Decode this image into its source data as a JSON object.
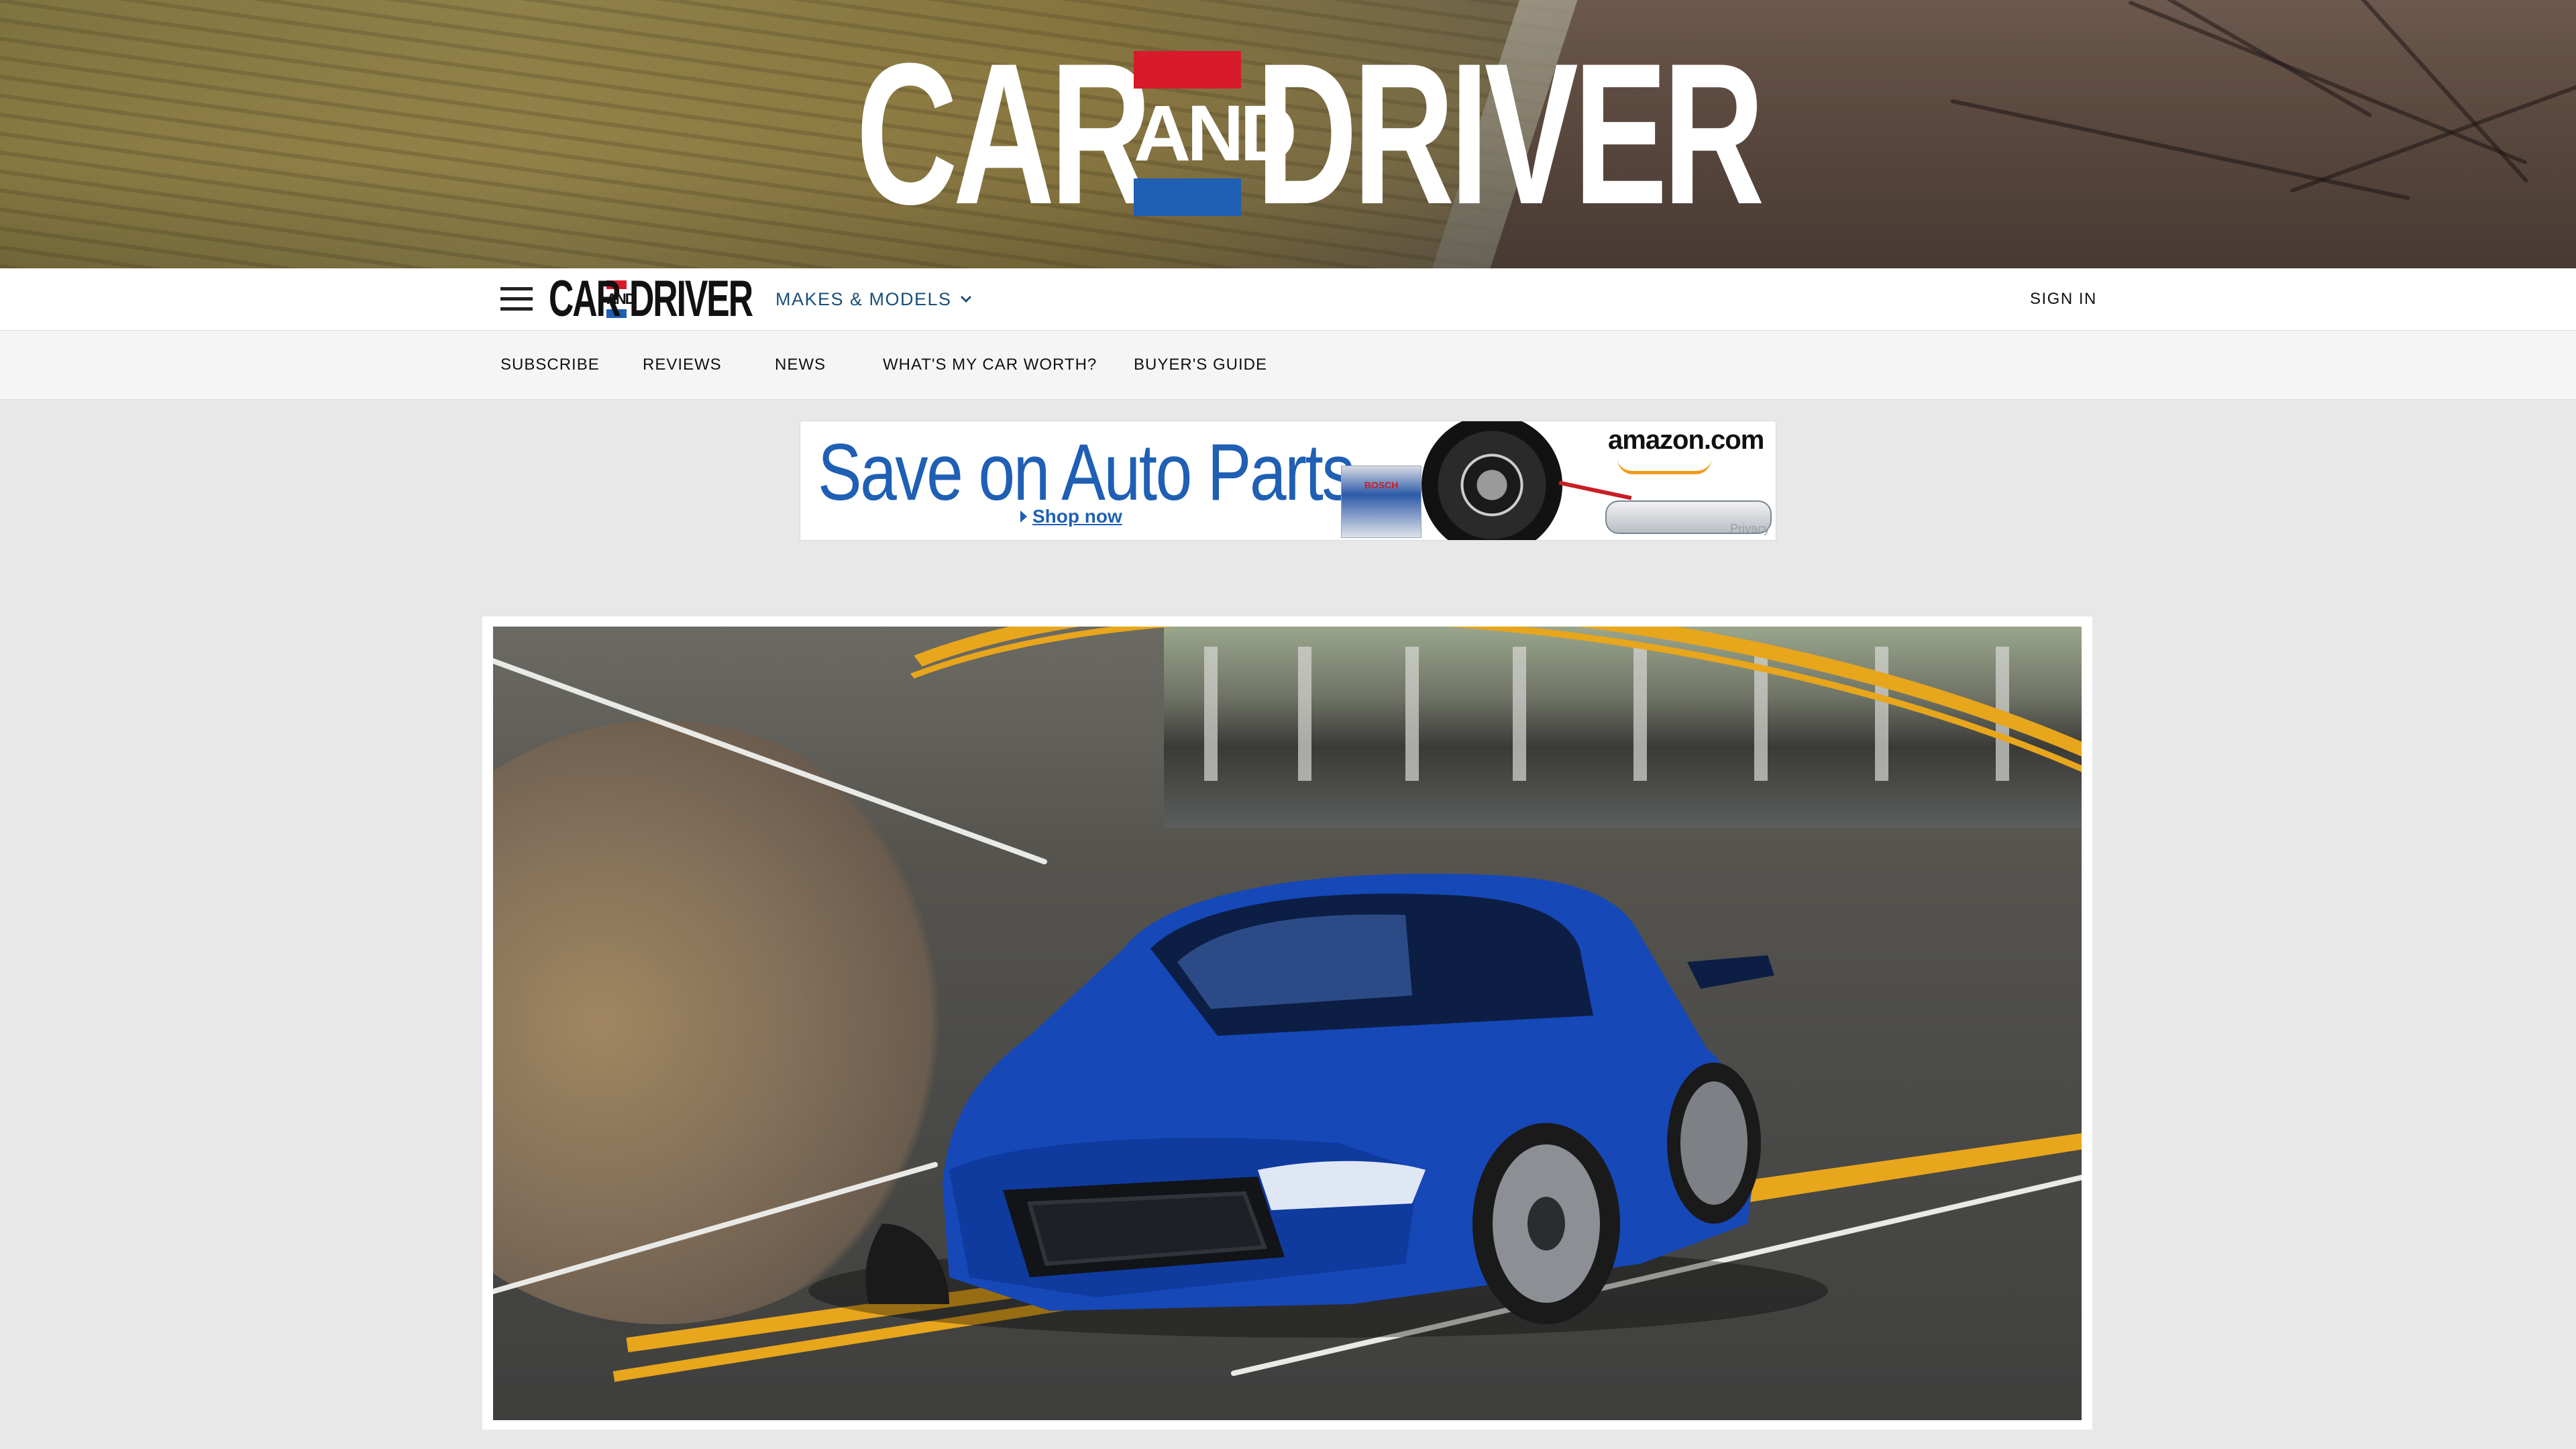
{
  "brand": {
    "logo_word_left": "CAR",
    "logo_word_mid": "AND",
    "logo_word_right": "DRIVER",
    "colors": {
      "red": "#d81b2a",
      "blue": "#1f5fb4",
      "link": "#1b4f7a"
    }
  },
  "topnav": {
    "menu_icon": "hamburger-menu-icon",
    "makes_label": "MAKES & MODELS",
    "makes_icon": "chevron-down-icon",
    "signin_label": "SIGN IN"
  },
  "subnav": {
    "items": [
      {
        "label": "SUBSCRIBE"
      },
      {
        "label": "REVIEWS"
      },
      {
        "label": "NEWS"
      },
      {
        "label": "WHAT'S MY CAR WORTH?"
      },
      {
        "label": "BUYER'S GUIDE"
      }
    ]
  },
  "ad": {
    "headline": "Save on Auto Parts",
    "cta": "Shop now",
    "advertiser": "amazon.com",
    "privacy": "Privacy",
    "product_label": "BOSCH"
  },
  "hero_image": {
    "subject": "blue-sports-car-on-curved-road-image"
  }
}
